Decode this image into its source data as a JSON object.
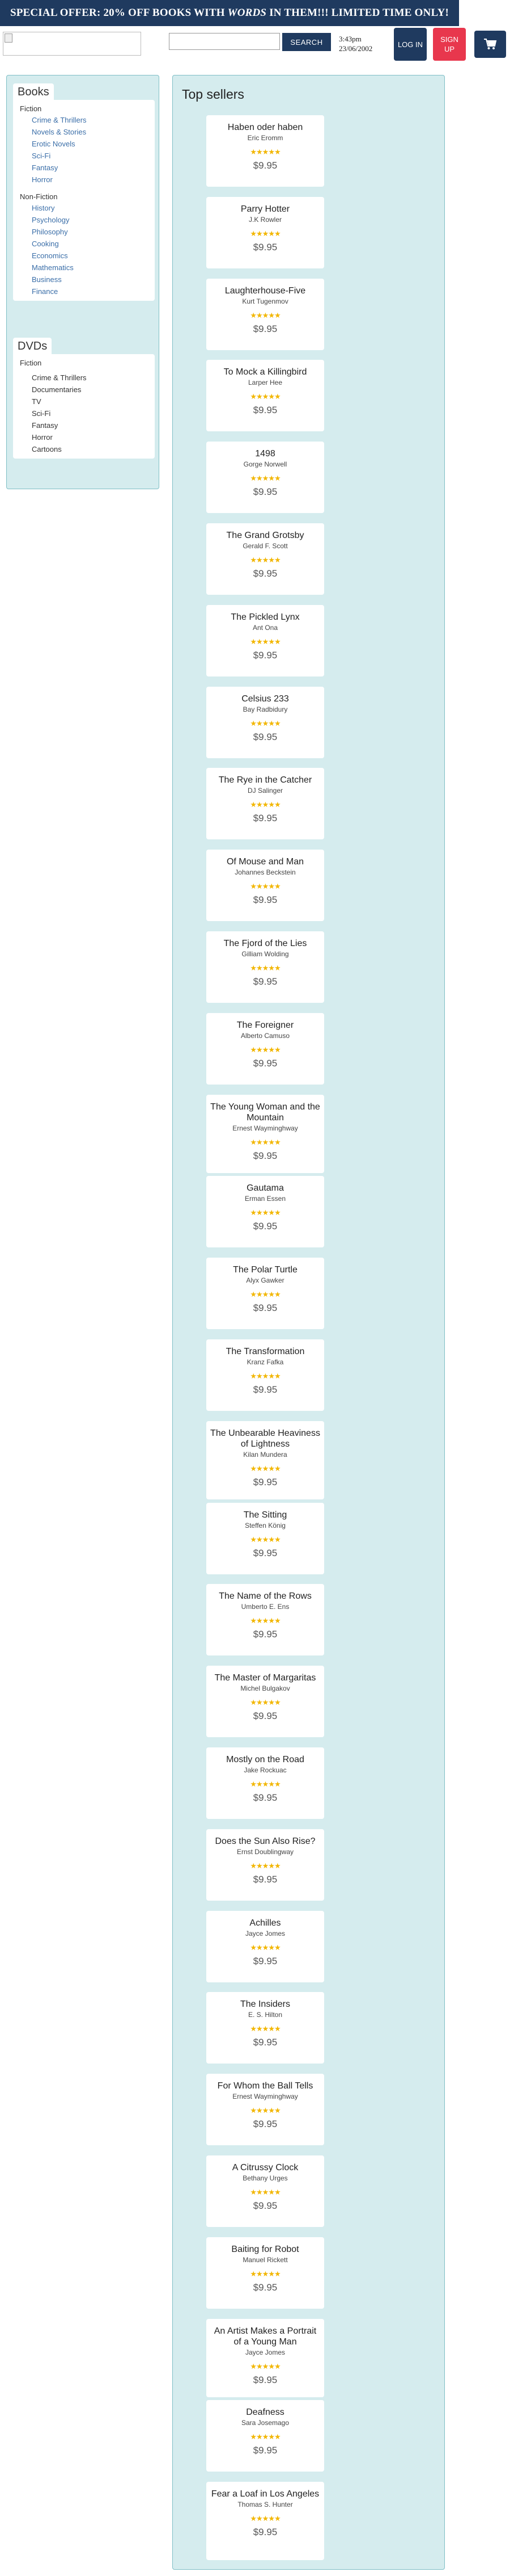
{
  "banner": {
    "pre": "SPECIAL OFFER: 20% OFF BOOKS WITH ",
    "emph": "WORDS",
    "post": " IN THEM!!! LIMITED TIME ONLY!"
  },
  "header": {
    "search_placeholder": "",
    "search_label": "SEARCH",
    "time": "3:43pm",
    "date": "23/06/2002",
    "login_label": "LOG IN",
    "signup_label": "SIGN UP",
    "cart_icon": "shopping-cart-icon"
  },
  "colors": {
    "navy": "#1f3a5f",
    "signup_red": "#e8374d",
    "panel_bg": "#d5ecee",
    "link_blue": "#3a6ea8",
    "star_gold": "#f2b600"
  },
  "sidebar": {
    "books": {
      "title": "Books",
      "fiction_label": "Fiction",
      "fiction": [
        "Crime & Thrillers",
        "Novels & Stories",
        "Erotic Novels",
        "Sci-Fi",
        "Fantasy",
        "Horror"
      ],
      "nonfiction_label": "Non-Fiction",
      "nonfiction": [
        "History",
        "Psychology",
        "Philosophy",
        "Cooking",
        "Economics",
        "Mathematics",
        "Business",
        "Finance"
      ]
    },
    "dvds": {
      "title": "DVDs",
      "fiction_label": "Fiction",
      "items": [
        "Crime & Thrillers",
        "Documentaries",
        "TV",
        "Sci-Fi",
        "Fantasy",
        "Horror",
        "Cartoons"
      ]
    }
  },
  "main": {
    "title": "Top sellers",
    "books": [
      {
        "title": "Haben oder haben",
        "author": "Eric Eromm",
        "rating": 5,
        "price": "$9.95"
      },
      {
        "title": "Parry Hotter",
        "author": "J.K Rowler",
        "rating": 5,
        "price": "$9.95"
      },
      {
        "title": "Laughterhouse-Five",
        "author": "Kurt Tugenmov",
        "rating": 5,
        "price": "$9.95"
      },
      {
        "title": "To Mock a Killingbird",
        "author": "Larper Hee",
        "rating": 5,
        "price": "$9.95"
      },
      {
        "title": "1498",
        "author": "Gorge Norwell",
        "rating": 5,
        "price": "$9.95"
      },
      {
        "title": "The Grand Grotsby",
        "author": "Gerald F. Scott",
        "rating": 5,
        "price": "$9.95"
      },
      {
        "title": "The Pickled Lynx",
        "author": "Ant Ona",
        "rating": 5,
        "price": "$9.95"
      },
      {
        "title": "Celsius 233",
        "author": "Bay Radbidury",
        "rating": 5,
        "price": "$9.95"
      },
      {
        "title": "The Rye in the Catcher",
        "author": "DJ Salinger",
        "rating": 5,
        "price": "$9.95"
      },
      {
        "title": "Of Mouse and Man",
        "author": "Johannes Beckstein",
        "rating": 5,
        "price": "$9.95"
      },
      {
        "title": "The Fjord of the Lies",
        "author": "Gilliam Wolding",
        "rating": 5,
        "price": "$9.95"
      },
      {
        "title": "The Foreigner",
        "author": "Alberto Camuso",
        "rating": 5,
        "price": "$9.95"
      },
      {
        "title": "The Young Woman and the Mountain",
        "author": "Ernest Wayminghway",
        "rating": 5,
        "price": "$9.95"
      },
      {
        "title": "Gautama",
        "author": "Erman Essen",
        "rating": 5,
        "price": "$9.95"
      },
      {
        "title": "The Polar Turtle",
        "author": "Alyx Gawker",
        "rating": 5,
        "price": "$9.95"
      },
      {
        "title": "The Transformation",
        "author": "Kranz Fafka",
        "rating": 5,
        "price": "$9.95"
      },
      {
        "title": "The Unbearable Heaviness of Lightness",
        "author": "Kilan Mundera",
        "rating": 5,
        "price": "$9.95"
      },
      {
        "title": "The Sitting",
        "author": "Steffen König",
        "rating": 5,
        "price": "$9.95"
      },
      {
        "title": "The Name of the Rows",
        "author": "Umberto E. Ens",
        "rating": 5,
        "price": "$9.95"
      },
      {
        "title": "The Master of Margaritas",
        "author": "Michel Bulgakov",
        "rating": 5,
        "price": "$9.95"
      },
      {
        "title": "Mostly on the Road",
        "author": "Jake Rockuac",
        "rating": 5,
        "price": "$9.95"
      },
      {
        "title": "Does the Sun Also Rise?",
        "author": "Ernst Doublingway",
        "rating": 5,
        "price": "$9.95"
      },
      {
        "title": "Achilles",
        "author": "Jayce Jomes",
        "rating": 5,
        "price": "$9.95"
      },
      {
        "title": "The Insiders",
        "author": "E. S. Hilton",
        "rating": 5,
        "price": "$9.95"
      },
      {
        "title": "For Whom the Ball Tells",
        "author": "Ernest Wayminghway",
        "rating": 5,
        "price": "$9.95"
      },
      {
        "title": "A Citrussy Clock",
        "author": "Bethany Urges",
        "rating": 5,
        "price": "$9.95"
      },
      {
        "title": "Baiting for Robot",
        "author": "Manuel Rickett",
        "rating": 5,
        "price": "$9.95"
      },
      {
        "title": "An Artist Makes a Portrait of a Young Man",
        "author": "Jayce Jomes",
        "rating": 5,
        "price": "$9.95"
      },
      {
        "title": "Deafness",
        "author": "Sara Josemago",
        "rating": 5,
        "price": "$9.95"
      },
      {
        "title": "Fear a Loaf in Los Angeles",
        "author": "Thomas S. Hunter",
        "rating": 5,
        "price": "$9.95"
      }
    ]
  }
}
